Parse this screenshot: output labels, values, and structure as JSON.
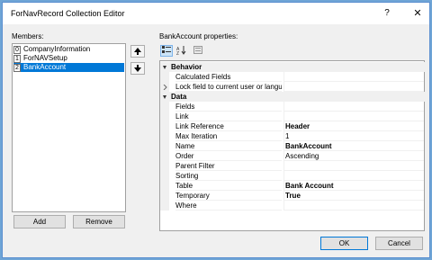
{
  "window": {
    "title": "ForNavRecord Collection Editor",
    "help_glyph": "?",
    "close_glyph": "✕"
  },
  "members": {
    "label": "Members:",
    "items": [
      {
        "index": "0",
        "name": "CompanyInformation",
        "selected": false
      },
      {
        "index": "1",
        "name": "ForNAVSetup",
        "selected": false
      },
      {
        "index": "2",
        "name": "BankAccount",
        "selected": true
      }
    ],
    "add_label": "Add",
    "remove_label": "Remove"
  },
  "properties": {
    "label": "BankAccount properties:",
    "categories": [
      {
        "name": "Behavior",
        "rows": [
          {
            "name": "Calculated Fields",
            "value": "",
            "bold": false,
            "expandable": false
          },
          {
            "name": "Lock field to current user or language",
            "value": "",
            "bold": false,
            "expandable": true
          }
        ]
      },
      {
        "name": "Data",
        "rows": [
          {
            "name": "Fields",
            "value": "",
            "bold": false
          },
          {
            "name": "Link",
            "value": "",
            "bold": false
          },
          {
            "name": "Link Reference",
            "value": "Header",
            "bold": true
          },
          {
            "name": "Max Iteration",
            "value": "1",
            "bold": false
          },
          {
            "name": "Name",
            "value": "BankAccount",
            "bold": true
          },
          {
            "name": "Order",
            "value": "Ascending",
            "bold": false
          },
          {
            "name": "Parent Filter",
            "value": "",
            "bold": false
          },
          {
            "name": "Sorting",
            "value": "",
            "bold": false
          },
          {
            "name": "Table",
            "value": "Bank Account",
            "bold": true
          },
          {
            "name": "Temporary",
            "value": "True",
            "bold": true
          },
          {
            "name": "Where",
            "value": "",
            "bold": false
          }
        ]
      }
    ]
  },
  "footer": {
    "ok_label": "OK",
    "cancel_label": "Cancel"
  },
  "colors": {
    "selection": "#0078d7",
    "frame": "#6fa5d6"
  }
}
